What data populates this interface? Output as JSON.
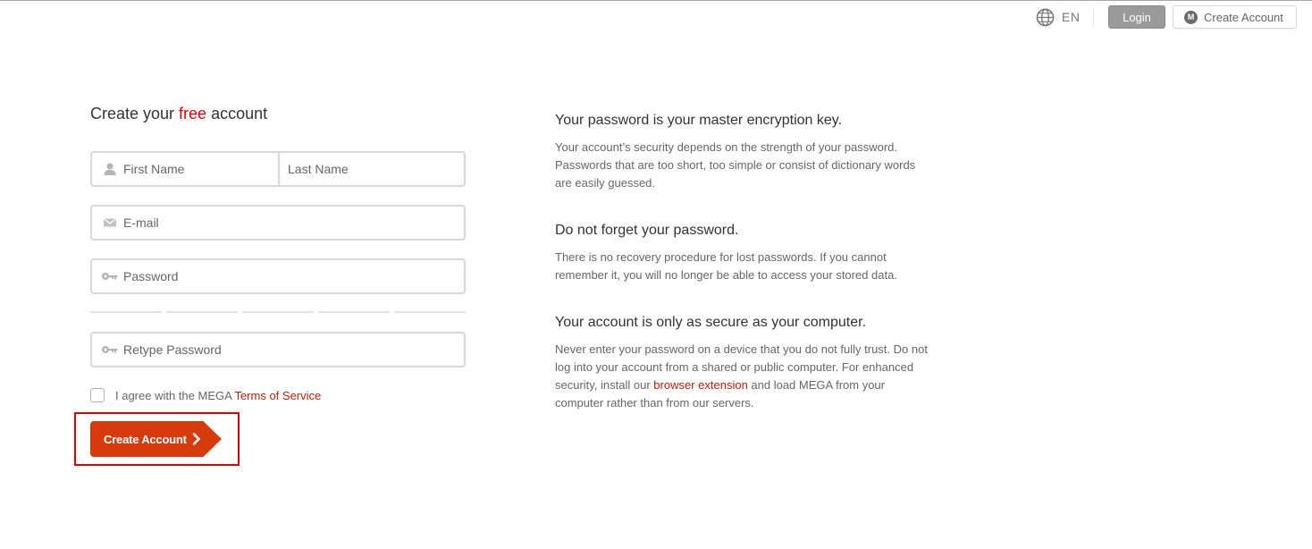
{
  "header": {
    "language": "EN",
    "login_label": "Login",
    "create_account_label": "Create Account",
    "logo_letter": "M"
  },
  "form": {
    "title_prefix": "Create your ",
    "title_highlight": "free",
    "title_suffix": " account",
    "first_name_placeholder": "First Name",
    "last_name_placeholder": "Last Name",
    "email_placeholder": "E-mail",
    "password_placeholder": "Password",
    "retype_password_placeholder": "Retype Password",
    "password_strength_segments": 5,
    "agree_text": "I agree with the MEGA ",
    "terms_link": "Terms of Service",
    "agree_checked": false,
    "submit_label": "Create Account"
  },
  "info": [
    {
      "heading": "Your password is your master encryption key.",
      "body": "Your account’s security depends on the strength of your password. Passwords that are too short, too simple or consist of dictionary words are easily guessed."
    },
    {
      "heading": "Do not forget your password.",
      "body": "There is no recovery procedure for lost passwords. If you cannot remember it, you will no longer be able to access your stored data."
    },
    {
      "heading": "Your account is only as secure as your computer.",
      "body_before_link": "Never enter your password on a device that you do not fully trust. Do not log into your account from a shared or public computer. For enhanced security, install our ",
      "link": "browser extension",
      "body_after_link": " and load MEGA from your computer rather than from our servers."
    }
  ],
  "colors": {
    "accent_red": "#d90007",
    "button_red": "#d73a0d",
    "link_red": "#b8200e",
    "login_gray": "#9a9a9a"
  }
}
